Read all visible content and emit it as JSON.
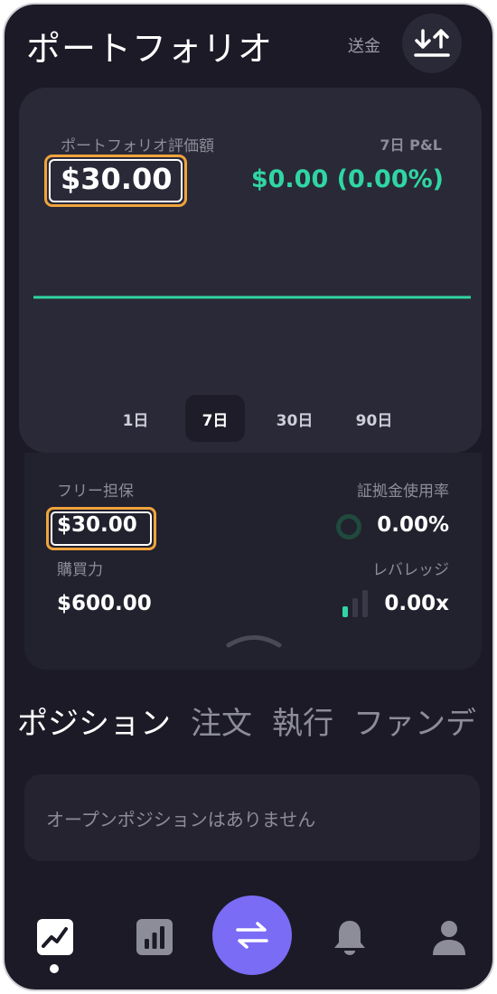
{
  "header": {
    "title": "ポートフォリオ",
    "send_label": "送金",
    "transfer_icon": "upload-download-icon"
  },
  "summary": {
    "portfolio_value_label": "ポートフォリオ評価額",
    "portfolio_value": "$30.00",
    "pnl_label": "7日 P&L",
    "pnl_value": "$0.00 (0.00%)",
    "line_color": "#2fd6a3",
    "chart_data": {
      "type": "line",
      "series": [
        {
          "values": [
            30.0,
            30.0,
            30.0,
            30.0,
            30.0,
            30.0,
            30.0,
            30.0
          ]
        }
      ]
    },
    "ranges": [
      "1日",
      "7日",
      "30日",
      "90日"
    ],
    "selected_range": "7日"
  },
  "collateral": {
    "free_label": "フリー担保",
    "free_value": "$30.00",
    "margin_usage_label": "証拠金使用率",
    "margin_usage_value": "0.00%",
    "margin_usage_fraction": 0,
    "buying_power_label": "購買力",
    "buying_power_value": "$600.00",
    "leverage_label": "レバレッジ",
    "leverage_value": "0.00x"
  },
  "tabs": [
    "ポジション",
    "注文",
    "執行",
    "ファンデ"
  ],
  "active_tab": "ポジション",
  "empty_message": "オープンポジションはありません",
  "nav": {
    "items": [
      "portfolio-icon",
      "chart-bars-icon",
      "swap-icon",
      "bell-icon",
      "user-icon"
    ],
    "accent_color": "#7a6cf5"
  },
  "colors": {
    "highlight": "#f0a33c",
    "positive": "#2fd6a3",
    "background": "#1b1a26",
    "card": "#2a2937"
  }
}
